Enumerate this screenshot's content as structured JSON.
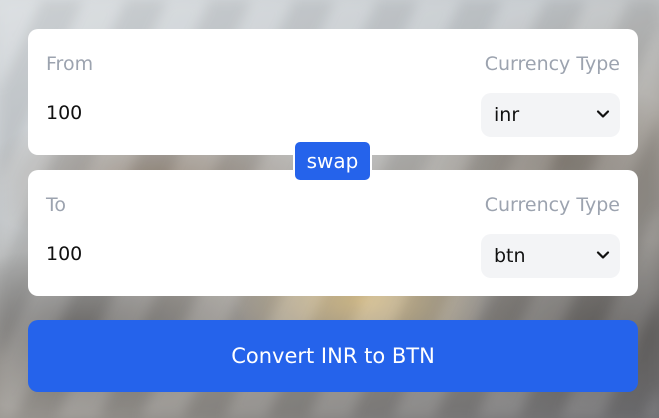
{
  "from": {
    "label": "From",
    "currency_type_label": "Currency Type",
    "amount": "100",
    "currency": "inr"
  },
  "swap": {
    "label": "swap"
  },
  "to": {
    "label": "To",
    "currency_type_label": "Currency Type",
    "amount": "100",
    "currency": "btn"
  },
  "convert": {
    "label": "Convert INR to BTN"
  },
  "icons": {
    "select_arrow": "chevron-down-icon"
  },
  "colors": {
    "accent": "#2563eb",
    "label": "#9ca3af",
    "select_bg": "#f3f4f6"
  }
}
